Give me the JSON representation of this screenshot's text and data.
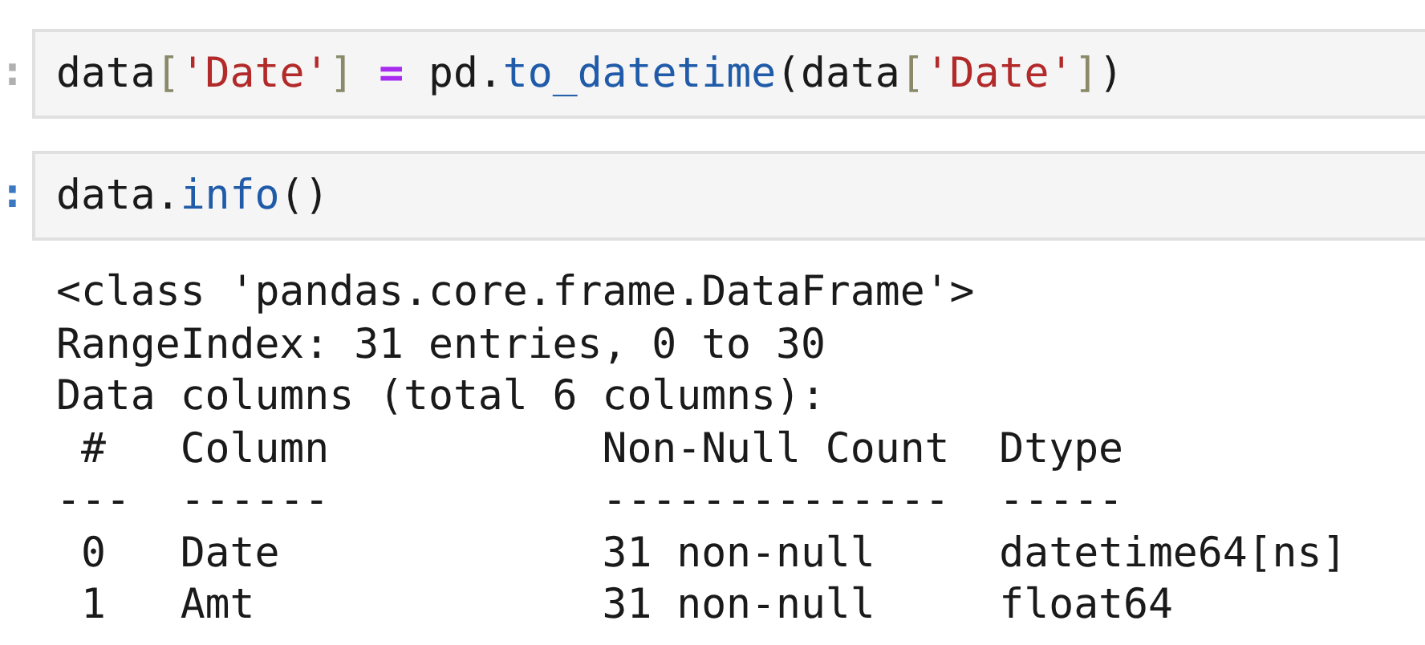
{
  "cells": [
    {
      "prompt": ":",
      "color": "#b0b0b0",
      "tokens": [
        {
          "text": "data",
          "kind": "plain"
        },
        {
          "text": "[",
          "kind": "bracket"
        },
        {
          "text": "'Date'",
          "kind": "string"
        },
        {
          "text": "]",
          "kind": "bracket"
        },
        {
          "text": " = ",
          "kind": "operator"
        },
        {
          "text": "pd.",
          "kind": "plain"
        },
        {
          "text": "to_datetime",
          "kind": "name"
        },
        {
          "text": "(data",
          "kind": "plain"
        },
        {
          "text": "[",
          "kind": "bracket"
        },
        {
          "text": "'Date'",
          "kind": "string"
        },
        {
          "text": "]",
          "kind": "bracket"
        },
        {
          "text": ")",
          "kind": "plain"
        }
      ]
    },
    {
      "prompt": ":",
      "color": "#3b78c2",
      "tokens": [
        {
          "text": "data.",
          "kind": "plain"
        },
        {
          "text": "info",
          "kind": "name"
        },
        {
          "text": "()",
          "kind": "plain"
        }
      ],
      "output": [
        "<class 'pandas.core.frame.DataFrame'>",
        "RangeIndex: 31 entries, 0 to 30",
        "Data columns (total 6 columns):",
        " #   Column           Non-Null Count  Dtype",
        "---  ------           --------------  -----",
        " 0   Date             31 non-null     datetime64[ns]",
        " 1   Amt              31 non-null     float64"
      ]
    }
  ]
}
